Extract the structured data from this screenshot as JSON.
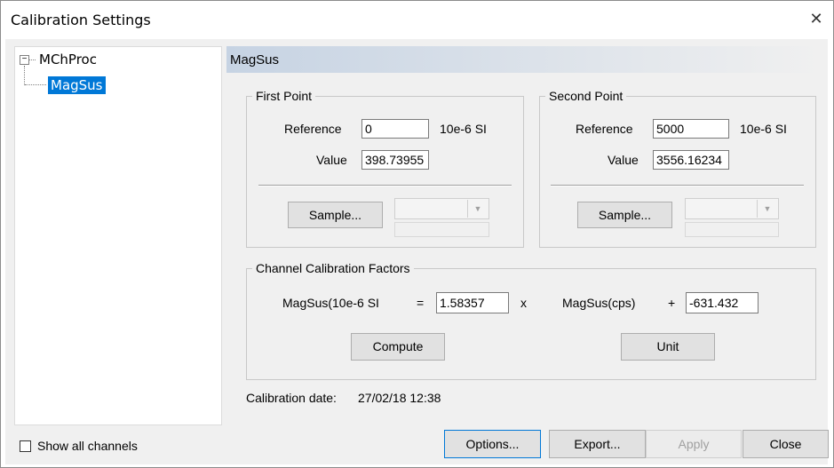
{
  "window": {
    "title": "Calibration Settings",
    "close_glyph": "✕"
  },
  "tree": {
    "expander": "−",
    "root": "MChProc",
    "child": "MagSus"
  },
  "panel": {
    "header": "MagSus"
  },
  "first_point": {
    "title": "First Point",
    "reference_label": "Reference",
    "reference_value": "0",
    "reference_unit": "10e-6 SI",
    "value_label": "Value",
    "value_value": "398.73955",
    "sample_label": "Sample...",
    "combo_arrow": "▼"
  },
  "second_point": {
    "title": "Second Point",
    "reference_label": "Reference",
    "reference_value": "5000",
    "reference_unit": "10e-6 SI",
    "value_label": "Value",
    "value_value": "3556.16234",
    "sample_label": "Sample...",
    "combo_arrow": "▼"
  },
  "factors": {
    "title": "Channel Calibration Factors",
    "output_label": "MagSus(10e-6 SI",
    "equals": "=",
    "multiplier": "1.58357",
    "times": "x",
    "input_label": "MagSus(cps)",
    "plus": "+",
    "offset": "-631.432",
    "compute_label": "Compute",
    "unit_label": "Unit"
  },
  "calibration": {
    "date_label": "Calibration date:",
    "date_value": "27/02/18 12:38"
  },
  "footer": {
    "show_all_label": "Show all channels",
    "options_label": "Options...",
    "export_label": "Export...",
    "apply_label": "Apply",
    "close_label": "Close"
  },
  "colors": {
    "selection": "#0078d7",
    "header_gradient_start": "#c6d3e3",
    "dialog_bg": "#f0f0f0"
  }
}
